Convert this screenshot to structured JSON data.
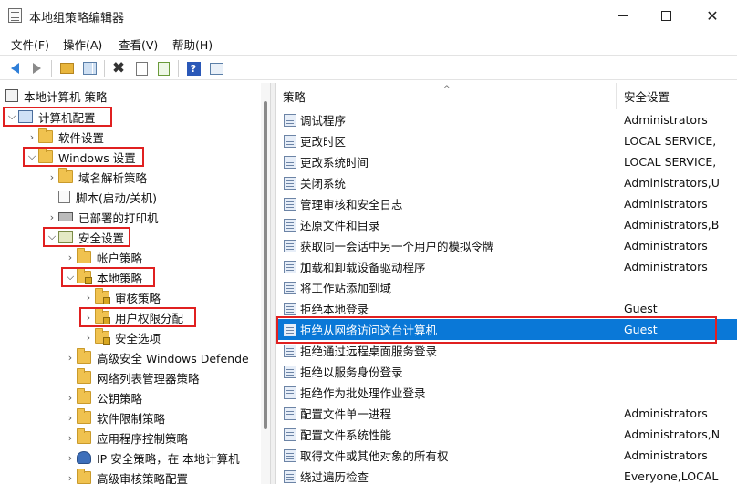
{
  "window": {
    "title": "本地组策略编辑器",
    "minimize": "—",
    "close": "✕"
  },
  "menu": [
    "文件(F)",
    "操作(A)",
    "查看(V)",
    "帮助(H)"
  ],
  "toolbar": {
    "icons": [
      "back-arrow-icon",
      "forward-arrow-icon",
      "up-folder-icon",
      "show-hide-tree-icon",
      "delete-icon",
      "properties-icon",
      "export-list-icon",
      "help-icon",
      "view-pane-icon"
    ],
    "delete_glyph": "✖",
    "help_glyph": "?"
  },
  "tree": {
    "root": "本地计算机 策略",
    "nodes": [
      {
        "label": "计算机配置",
        "chevron": "⌵",
        "icon": "computer-icon"
      },
      {
        "label": "软件设置",
        "chevron": "›",
        "icon": "folder-icon"
      },
      {
        "label": "Windows 设置",
        "chevron": "⌵",
        "icon": "folder-icon"
      },
      {
        "label": "域名解析策略",
        "chevron": "›",
        "icon": "folder-icon"
      },
      {
        "label": "脚本(启动/关机)",
        "chevron": "",
        "icon": "script-icon"
      },
      {
        "label": "已部署的打印机",
        "chevron": "›",
        "icon": "printer-icon"
      },
      {
        "label": "安全设置",
        "chevron": "⌵",
        "icon": "security-icon"
      },
      {
        "label": "帐户策略",
        "chevron": "›",
        "icon": "folder-icon"
      },
      {
        "label": "本地策略",
        "chevron": "⌵",
        "icon": "folder-lock-icon"
      },
      {
        "label": "审核策略",
        "chevron": "›",
        "icon": "folder-lock-icon"
      },
      {
        "label": "用户权限分配",
        "chevron": "›",
        "icon": "folder-lock-icon"
      },
      {
        "label": "安全选项",
        "chevron": "›",
        "icon": "folder-lock-icon"
      },
      {
        "label": "高级安全 Windows Defende",
        "chevron": "›",
        "icon": "folder-icon"
      },
      {
        "label": "网络列表管理器策略",
        "chevron": "",
        "icon": "folder-icon"
      },
      {
        "label": "公钥策略",
        "chevron": "›",
        "icon": "folder-icon"
      },
      {
        "label": "软件限制策略",
        "chevron": "›",
        "icon": "folder-icon"
      },
      {
        "label": "应用程序控制策略",
        "chevron": "›",
        "icon": "folder-icon"
      },
      {
        "label": "IP 安全策略，在 本地计算机",
        "chevron": "›",
        "icon": "ip-security-icon"
      },
      {
        "label": "高级审核策略配置",
        "chevron": "›",
        "icon": "folder-icon"
      }
    ]
  },
  "list": {
    "headers": {
      "policy": "策略",
      "setting": "安全设置",
      "sort": "^"
    },
    "rows": [
      {
        "policy": "调试程序",
        "setting": "Administrators"
      },
      {
        "policy": "更改时区",
        "setting": "LOCAL SERVICE,"
      },
      {
        "policy": "更改系统时间",
        "setting": "LOCAL SERVICE,"
      },
      {
        "policy": "关闭系统",
        "setting": "Administrators,U"
      },
      {
        "policy": "管理审核和安全日志",
        "setting": "Administrators"
      },
      {
        "policy": "还原文件和目录",
        "setting": "Administrators,B"
      },
      {
        "policy": "获取同一会话中另一个用户的模拟令牌",
        "setting": "Administrators"
      },
      {
        "policy": "加载和卸载设备驱动程序",
        "setting": "Administrators"
      },
      {
        "policy": "将工作站添加到域",
        "setting": ""
      },
      {
        "policy": "拒绝本地登录",
        "setting": "Guest"
      },
      {
        "policy": "拒绝从网络访问这台计算机",
        "setting": "Guest"
      },
      {
        "policy": "拒绝通过远程桌面服务登录",
        "setting": ""
      },
      {
        "policy": "拒绝以服务身份登录",
        "setting": ""
      },
      {
        "policy": "拒绝作为批处理作业登录",
        "setting": ""
      },
      {
        "policy": "配置文件单一进程",
        "setting": "Administrators"
      },
      {
        "policy": "配置文件系统性能",
        "setting": "Administrators,N"
      },
      {
        "policy": "取得文件或其他对象的所有权",
        "setting": "Administrators"
      },
      {
        "policy": "绕过遍历检查",
        "setting": "Everyone,LOCAL"
      }
    ]
  }
}
